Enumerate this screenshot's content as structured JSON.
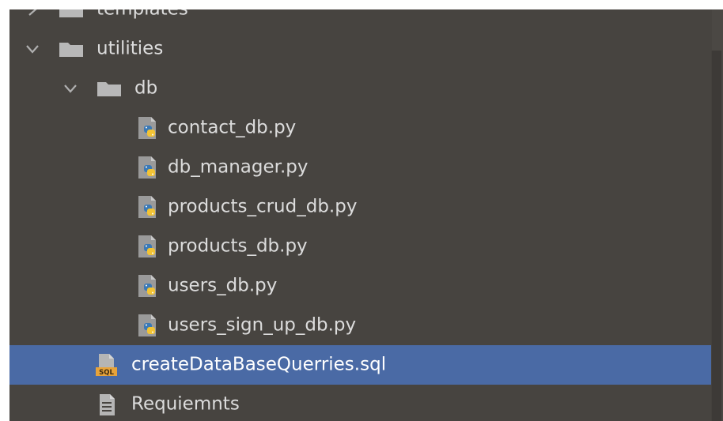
{
  "project_tree": {
    "items": [
      {
        "label": "templates",
        "type": "folder",
        "expanded": false,
        "icon": "folder-icon"
      },
      {
        "label": "utilities",
        "type": "folder",
        "expanded": true,
        "icon": "folder-icon"
      },
      {
        "label": "db",
        "type": "folder",
        "expanded": true,
        "icon": "folder-icon"
      },
      {
        "label": "contact_db.py",
        "type": "python-file",
        "icon": "python-file-icon"
      },
      {
        "label": "db_manager.py",
        "type": "python-file",
        "icon": "python-file-icon"
      },
      {
        "label": "products_crud_db.py",
        "type": "python-file",
        "icon": "python-file-icon"
      },
      {
        "label": "products_db.py",
        "type": "python-file",
        "icon": "python-file-icon"
      },
      {
        "label": "users_db.py",
        "type": "python-file",
        "icon": "python-file-icon"
      },
      {
        "label": "users_sign_up_db.py",
        "type": "python-file",
        "icon": "python-file-icon"
      },
      {
        "label": "createDataBaseQuerries.sql",
        "type": "sql-file",
        "icon": "sql-file-icon",
        "selected": true
      },
      {
        "label": "Requiemnts",
        "type": "text-file",
        "icon": "text-file-icon"
      }
    ]
  },
  "colors": {
    "background": "#474440",
    "selection": "#4a6aa5",
    "text": "#dcdcdc",
    "folder": "#b8b8b8"
  }
}
